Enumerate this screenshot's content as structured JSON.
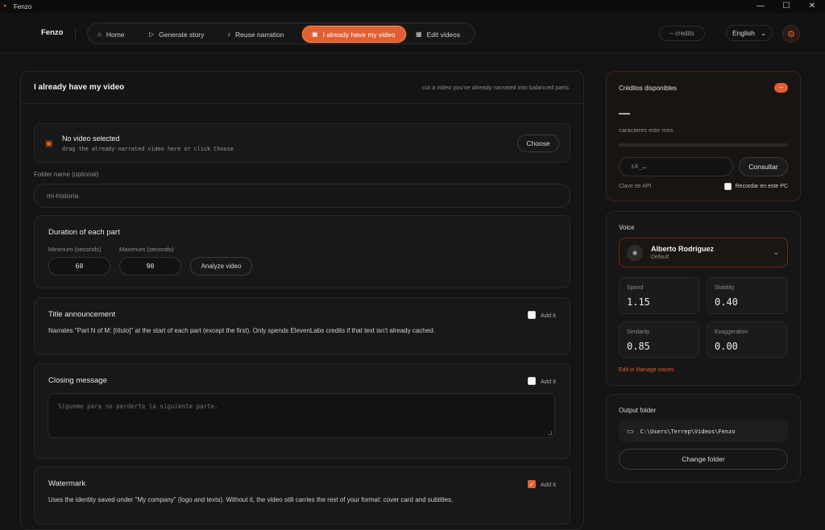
{
  "window": {
    "app_name": "Fenzo",
    "controls": [
      "—",
      "☐",
      "✕"
    ]
  },
  "nav": {
    "brand": "Fenzo",
    "items": [
      {
        "label": "Home",
        "icon": "home-icon",
        "glyph": "⌂"
      },
      {
        "label": "Generate story",
        "icon": "play-icon",
        "glyph": "▷"
      },
      {
        "label": "Reuse narration",
        "icon": "audio-icon",
        "glyph": "♪"
      },
      {
        "label": "I already have my video",
        "icon": "video-icon",
        "glyph": "▣"
      },
      {
        "label": "Edit videos",
        "icon": "grid-icon",
        "glyph": "▦"
      }
    ],
    "credits": "– credits",
    "language": "English",
    "language_chevron": "⌄",
    "settings_glyph": "⚙"
  },
  "main": {
    "title": "I already have my video",
    "subtitle": "cut a video you've already narrated into balanced parts",
    "video": {
      "title": "No video selected",
      "hint": "drag the already-narrated video here or click Choose",
      "choose": "Choose"
    },
    "folder": {
      "label": "Folder name (optional)",
      "value": "mi-historia"
    },
    "duration": {
      "title": "Duration of each part",
      "min_label": "Minimum (seconds)",
      "min_value": "60",
      "max_label": "Maximum (seconds)",
      "max_value": "90",
      "analyze": "Analyze video"
    },
    "title_announcement": {
      "title": "Title announcement",
      "add": "Add it",
      "checked": false,
      "desc": "Narrates \"Part N of M: [título]\" at the start of each part (except the first). Only spends ElevenLabs credits if that text isn't already cached."
    },
    "closing": {
      "title": "Closing message",
      "add": "Add it",
      "checked": false,
      "placeholder": "Sígueme para no perderte la siguiente parte."
    },
    "watermark": {
      "title": "Watermark",
      "add": "Add it",
      "checked": true,
      "desc": "Uses the identity saved under \"My company\" (logo and texts). Without it, the video still carries the rest of your format: cover card and subtitles."
    }
  },
  "credits_panel": {
    "title": "Créditos disponibles",
    "badge": "–",
    "value": "—",
    "sub": "caracteres este mes",
    "usage_fraction": 0,
    "key_placeholder": "sk_…",
    "button": "Consultar",
    "api_label": "Clave de API",
    "remember": "Recordar en este PC"
  },
  "voice": {
    "label": "Voice",
    "name": "Alberto Rodríguez",
    "default": "Default",
    "params": [
      {
        "label": "Speed",
        "value": "1.15"
      },
      {
        "label": "Stability",
        "value": "0.40"
      },
      {
        "label": "Similarity",
        "value": "0.85"
      },
      {
        "label": "Exaggeration",
        "value": "0.00"
      }
    ],
    "edit_link": "Edit in Manage voices"
  },
  "output": {
    "label": "Output folder",
    "path": "C:\\Users\\Terrep\\Videos\\Fenzo",
    "button": "Change folder"
  },
  "colors": {
    "accent": "#e05f32",
    "bg": "#131313"
  }
}
